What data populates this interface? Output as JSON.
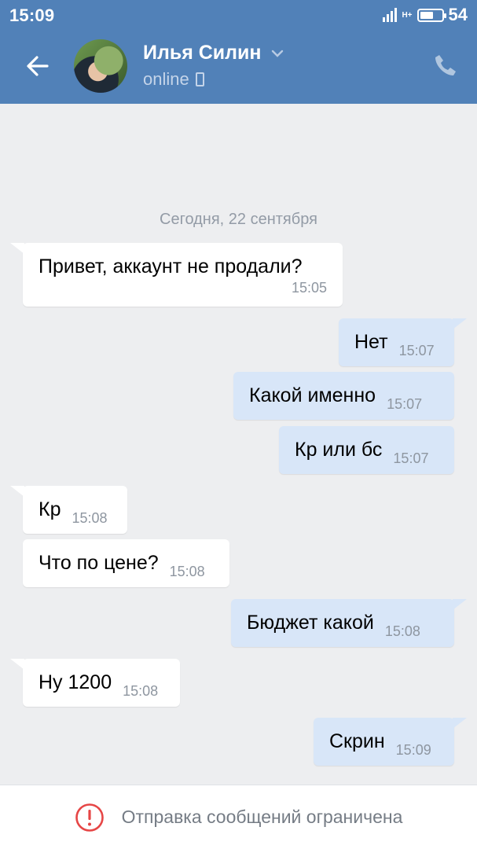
{
  "status_bar": {
    "time": "15:09",
    "network": "H+",
    "battery": "54",
    "battery_level": 0.54
  },
  "header": {
    "name": "Илья Силин",
    "status": "online",
    "icons": [
      "back-arrow-icon",
      "chevron-down-icon",
      "mobile-device-icon",
      "phone-call-icon"
    ]
  },
  "date_separator": "Сегодня, 22 сентября",
  "messages": [
    {
      "dir": "in",
      "text": "Привет, аккаунт не продали?",
      "time": "15:05"
    },
    {
      "dir": "out",
      "text": "Нет",
      "time": "15:07"
    },
    {
      "dir": "out",
      "text": "Какой именно",
      "time": "15:07"
    },
    {
      "dir": "out",
      "text": "Кр или бс",
      "time": "15:07"
    },
    {
      "dir": "in",
      "text": "Кр",
      "time": "15:08"
    },
    {
      "dir": "in",
      "text": "Что по цене?",
      "time": "15:08"
    },
    {
      "dir": "out",
      "text": "Бюджет какой",
      "time": "15:08"
    },
    {
      "dir": "in",
      "text": "Ну 1200",
      "time": "15:08"
    },
    {
      "dir": "out",
      "text": "Скрин",
      "time": "15:09"
    }
  ],
  "bottom": {
    "notice": "Отправка сообщений ограничена",
    "icon": "warning-icon",
    "accent": "#e64646"
  },
  "colors": {
    "header": "#5181b8",
    "background": "#edeef0",
    "incoming": "#ffffff",
    "outgoing": "#d8e6f8"
  }
}
